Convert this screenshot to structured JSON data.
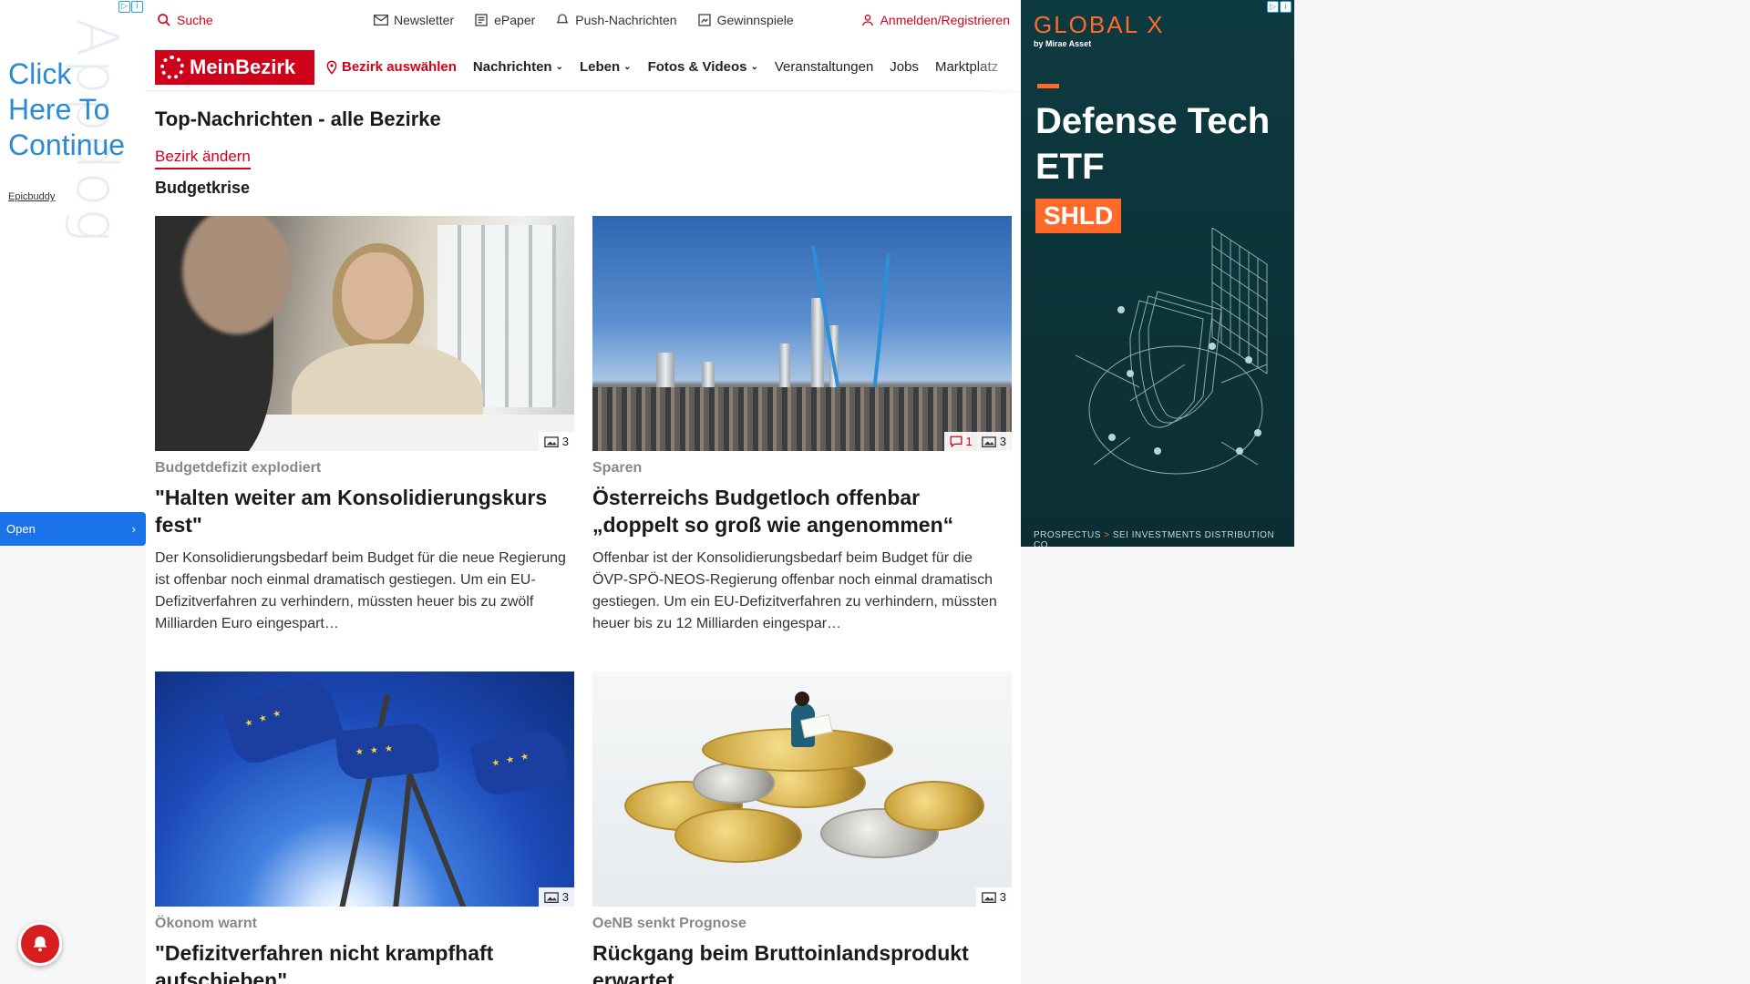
{
  "left_ad": {
    "watermark": "Appdog",
    "cta": [
      "Click",
      "Here To",
      "Continue"
    ],
    "brand": "Epicbuddy",
    "open_label": "Open"
  },
  "topbar": {
    "search": "Suche",
    "links": [
      "Newsletter",
      "ePaper",
      "Push-Nachrichten",
      "Gewinnspiele"
    ],
    "login": "Anmelden/Registrieren"
  },
  "navbar": {
    "logo": "MeinBezirk",
    "select_district": "Bezirk auswählen",
    "items": [
      {
        "label": "Nachrichten",
        "dropdown": true
      },
      {
        "label": "Leben",
        "dropdown": true
      },
      {
        "label": "Fotos & Videos",
        "dropdown": true
      },
      {
        "label": "Veranstaltungen",
        "dropdown": false
      },
      {
        "label": "Jobs",
        "dropdown": false
      },
      {
        "label": "Marktplatz",
        "dropdown": false
      }
    ]
  },
  "main": {
    "heading": "Top-Nachrichten - alle Bezirke",
    "change_district": "Bezirk ändern",
    "section": "Budgetkrise",
    "articles": [
      {
        "kicker": "Budgetdefizit explodiert",
        "title": "\"Halten weiter am Konsolidierungskurs fest\"",
        "teaser": "Der Konsolidierungsbedarf beim Budget für die neue Regierung ist offenbar noch einmal dramatisch gestiegen. Um ein EU-Defizitverfahren zu verhindern, müssten heuer bis zu zwölf Milliarden Euro eingespart…",
        "comments": null,
        "photos": "3"
      },
      {
        "kicker": "Sparen",
        "title": "Österreichs Budgetloch offenbar „doppelt so groß wie angenommen“",
        "teaser": "Offenbar ist der Konsolidierungsbedarf beim Budget für die ÖVP-SPÖ-NEOS-Regierung offenbar noch einmal dramatisch gestiegen. Um ein EU-Defizitverfahren zu verhindern, müssten heuer bis zu 12 Milliarden eingespar…",
        "comments": "1",
        "photos": "3"
      },
      {
        "kicker": "Ökonom warnt",
        "title": "\"Defizitverfahren nicht krampfhaft aufschieben\"",
        "teaser": "",
        "comments": null,
        "photos": "3"
      },
      {
        "kicker": "OeNB senkt Prognose",
        "title": "Rückgang beim Bruttoinlandsprodukt erwartet",
        "teaser": "",
        "comments": null,
        "photos": "3"
      }
    ]
  },
  "right_ad": {
    "brand": "GLOBAL X",
    "by": "by Mirae Asset",
    "headline": "Defense Tech ETF",
    "ticker": "SHLD",
    "footer_a": "PROSPECTUS",
    "footer_b": "SEI INVESTMENTS DISTRIBUTION CO."
  },
  "colors": {
    "brand_red": "#d0021b",
    "ad_orange": "#ff6a2a",
    "open_blue": "#1a73e8"
  }
}
